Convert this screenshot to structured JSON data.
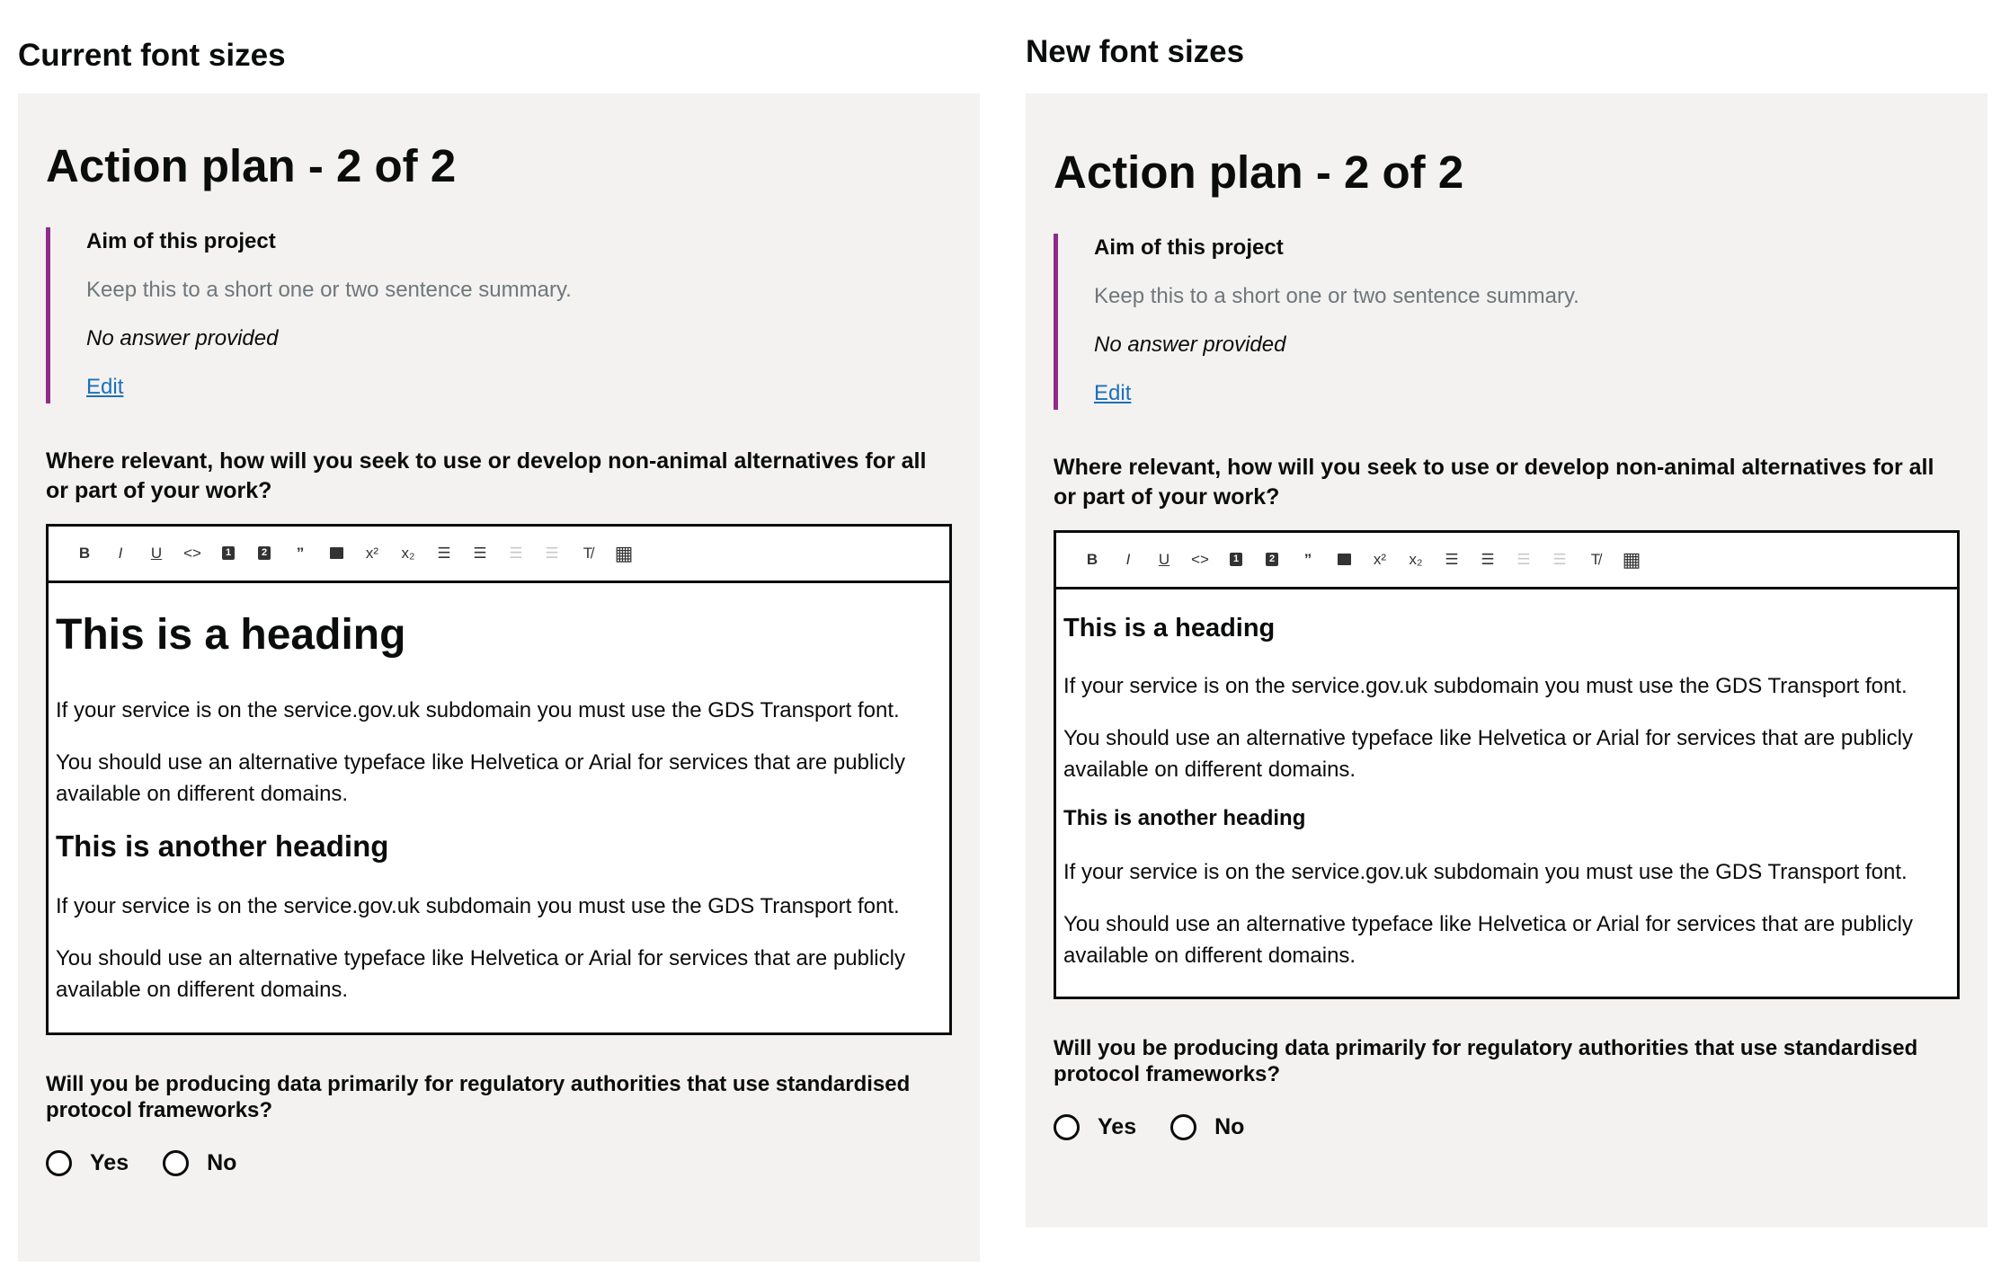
{
  "columns": {
    "current": {
      "title": "Current font sizes",
      "page_heading": "Action plan - 2 of 2",
      "inset": {
        "title": "Aim of this project",
        "hint": "Keep this to a short one or two sentence summary.",
        "empty": "No answer provided",
        "edit": "Edit"
      },
      "question": "Where relevant, how will you seek to use or develop non-animal alternatives for all or part of your work?",
      "editor": {
        "heading1": "This is a heading",
        "p1": "If your service is on the service.gov.uk subdomain you must use the GDS Transport font.",
        "p2": "You should use an alternative typeface like Helvetica or Arial for services that are publicly available on different domains.",
        "heading2": "This is another heading",
        "p3": "If your service is on the service.gov.uk subdomain you must use the GDS Transport font.",
        "p4": "You should use an alternative typeface like Helvetica or Arial for services that are publicly available on different domains."
      },
      "question2": "Will you be producing data primarily for regulatory authorities that use standardised protocol frameworks?",
      "yes": "Yes",
      "no": "No"
    },
    "new": {
      "title": "New font sizes",
      "page_heading": "Action plan - 2 of 2",
      "inset": {
        "title": "Aim of this project",
        "hint": "Keep this to a short one or two sentence summary.",
        "empty": "No answer provided",
        "edit": "Edit"
      },
      "question": "Where relevant, how will you seek to use or develop non-animal alternatives for all or part of your work?",
      "editor": {
        "heading1": "This is a heading",
        "p1": "If your service is on the service.gov.uk subdomain you must use the GDS Transport font.",
        "p2": "You should use an alternative typeface like Helvetica or Arial for services that are publicly available on different domains.",
        "heading2": "This is another heading",
        "p3": "If your service is on the service.gov.uk subdomain you must use the GDS Transport font.",
        "p4": "You should use an alternative typeface like Helvetica or Arial for services that are publicly available on different domains."
      },
      "question2": "Will you be producing data primarily for regulatory authorities that use standardised protocol frameworks?",
      "yes": "Yes",
      "no": "No"
    }
  },
  "toolbar": {
    "bold": "B",
    "italic": "I",
    "underline": "U",
    "code": "<>",
    "h1": "1",
    "h2": "2",
    "quote": "”",
    "superscript": "x²",
    "subscript": "x₂",
    "bullet_list": "☰",
    "numbered_list": "☰",
    "outdent": "☰",
    "indent": "☰",
    "clear_format": "T̸",
    "table": "▦"
  },
  "colors": {
    "panel_bg": "#f3f2f1",
    "inset_border": "#912b88",
    "link": "#1d70b8",
    "hint": "#6f777b"
  }
}
